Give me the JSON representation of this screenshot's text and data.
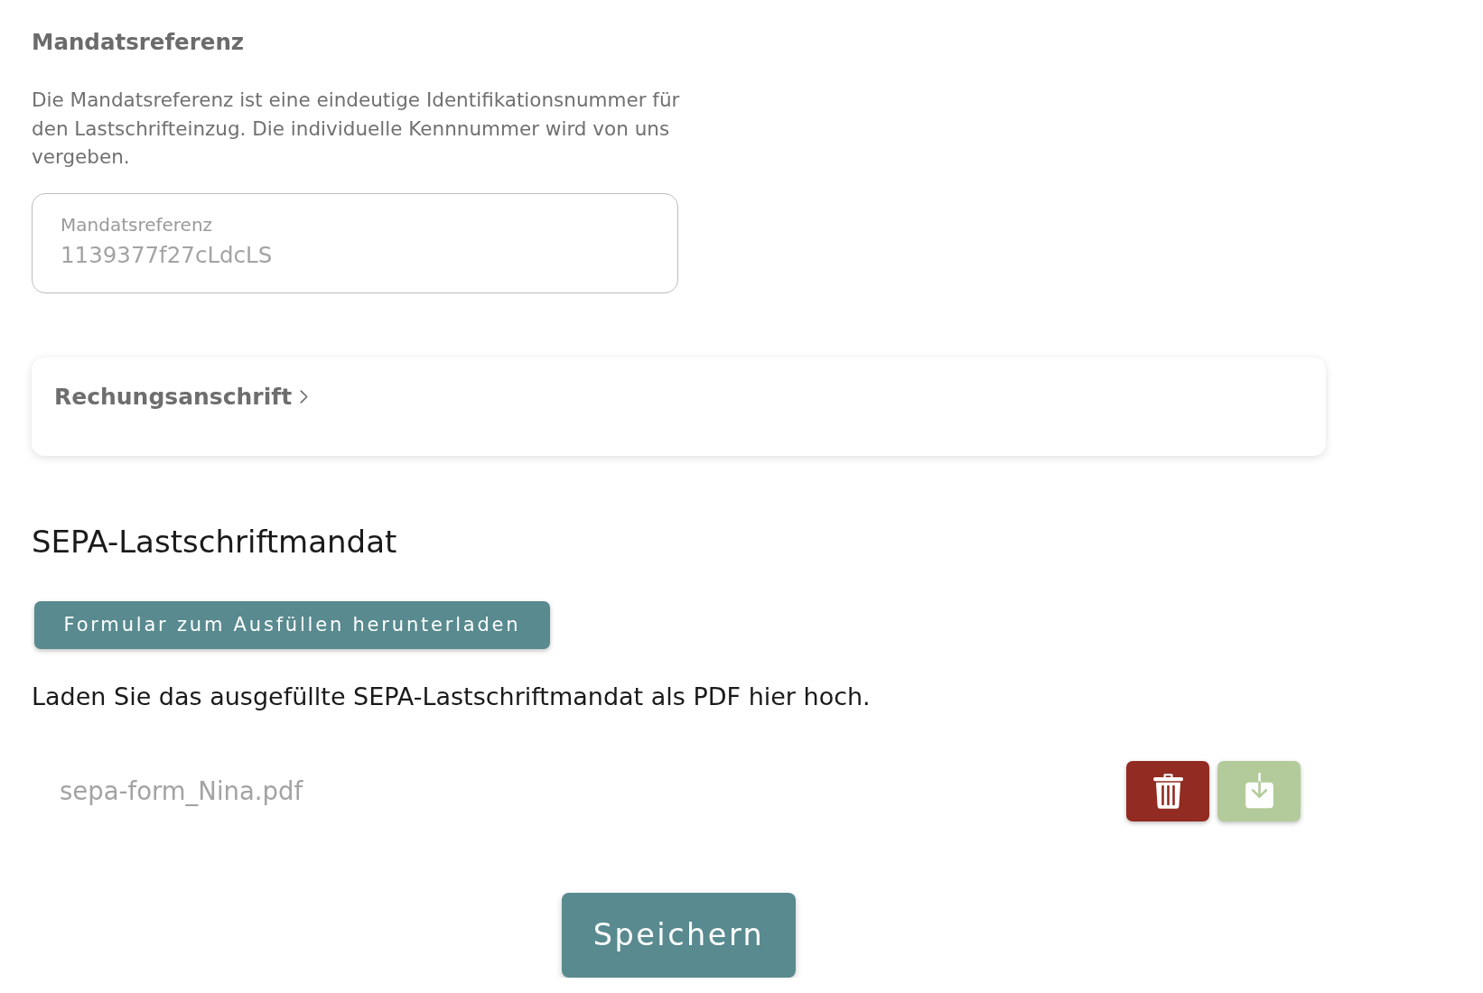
{
  "mandate_reference": {
    "heading": "Mandatsreferenz",
    "description": "Die Mandatsreferenz ist eine eindeutige Identifikationsnummer für den Lastschrifteinzug. Die individuelle Kennnummer wird von uns vergeben.",
    "field": {
      "label": "Mandatsreferenz",
      "value": "1139377f27cLdcLS"
    }
  },
  "billing_address": {
    "title": "Rechungsanschrift",
    "expanded": false
  },
  "sepa_mandate": {
    "heading": "SEPA-Lastschriftmandat",
    "download_form_button": "Formular zum Ausfüllen herunterladen",
    "instruction": "Laden Sie das ausgefüllte SEPA-Lastschriftmandat als PDF hier hoch.",
    "file": {
      "name": "sepa-form_Nina.pdf"
    }
  },
  "save_button": "Speichern"
}
